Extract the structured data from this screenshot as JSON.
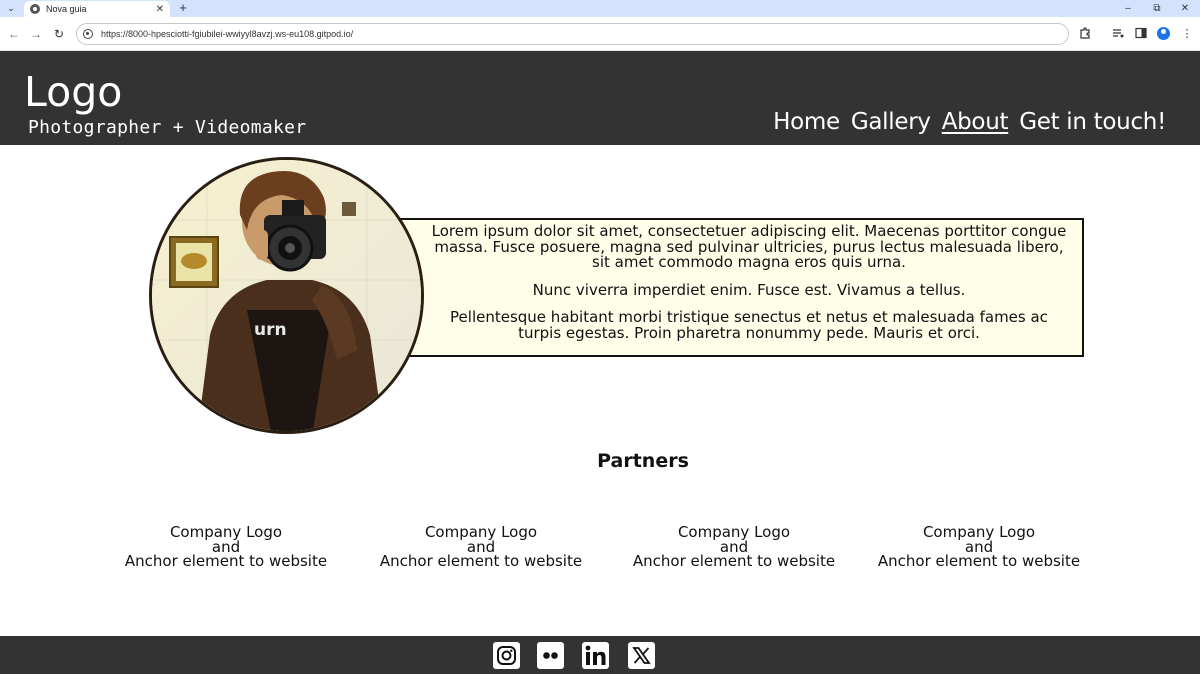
{
  "browser": {
    "tab_title": "Nova guia",
    "url": "https://8000-hpesciotti-fgiubilei-wwiyyl8avzj.ws-eu108.gitpod.io/"
  },
  "header": {
    "logo": "Logo",
    "tagline": "Photographer + Videomaker",
    "nav": [
      {
        "label": "Home",
        "active": false
      },
      {
        "label": "Gallery",
        "active": false
      },
      {
        "label": "About",
        "active": true
      },
      {
        "label": "Get in touch!",
        "active": false
      }
    ]
  },
  "about": {
    "paragraphs": [
      "Lorem ipsum dolor sit amet, consectetuer adipiscing elit. Maecenas porttitor congue massa. Fusce posuere, magna sed pulvinar ultricies, purus lectus malesuada libero, sit amet commodo magna eros quis urna.",
      "Nunc viverra imperdiet enim. Fusce est. Vivamus a tellus.",
      "Pellentesque habitant morbi tristique senectus et netus et malesuada fames ac turpis egestas. Proin pharetra nonummy pede. Mauris et orci."
    ],
    "box_color": "#fffee8"
  },
  "partners": {
    "title": "Partners",
    "items": [
      {
        "line1": "Company Logo",
        "line2": "and",
        "line3": "Anchor element to website"
      },
      {
        "line1": "Company Logo",
        "line2": "and",
        "line3": "Anchor element to website"
      },
      {
        "line1": "Company Logo",
        "line2": "and",
        "line3": "Anchor element to website"
      },
      {
        "line1": "Company Logo",
        "line2": "and",
        "line3": "Anchor element to website"
      }
    ]
  },
  "footer": {
    "social": [
      "instagram-icon",
      "flickr-icon",
      "linkedin-icon",
      "x-twitter-icon"
    ]
  },
  "colors": {
    "header_bg": "#333333",
    "footer_bg": "#333333",
    "tabstrip_bg": "#d3e3fd"
  }
}
